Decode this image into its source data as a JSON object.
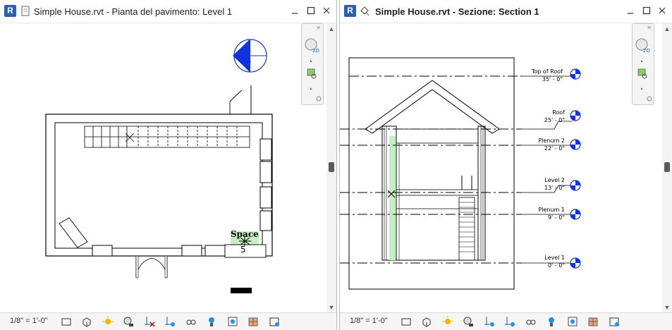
{
  "left_view": {
    "title": "Simple House.rvt - Pianta del pavimento: Level 1",
    "scale": "1/8\" = 1'-0\"",
    "space_tag": {
      "label": "Space",
      "number": "5"
    },
    "elevation_tag": {
      "top": ".",
      "bottom": "..."
    }
  },
  "right_view": {
    "title": "Simple House.rvt - Sezione: Section 1",
    "scale": "1/8\" = 1'-0\"",
    "levels": [
      {
        "name": "Top of Roof",
        "elevation": "35' - 0\""
      },
      {
        "name": "Roof",
        "elevation": "25' - 0\""
      },
      {
        "name": "Plenum 2",
        "elevation": "22' - 0\""
      },
      {
        "name": "Level 2",
        "elevation": "13' - 0\""
      },
      {
        "name": "Plenum 1",
        "elevation": "9' - 0\""
      },
      {
        "name": "Level 1",
        "elevation": "0' - 0\""
      }
    ]
  },
  "app": {
    "logo": "R"
  },
  "icons": [
    "model-graphics-icon",
    "visual-style-icon",
    "sun-path-icon",
    "shadows-icon",
    "crop-view-icon",
    "show-crop-icon",
    "temporary-hide-icon",
    "reveal-hidden-icon",
    "analytical-model-icon",
    "highlight-displacement-icon",
    "worksharing-icon",
    "constraints-icon"
  ],
  "colors": {
    "accent": "#1133dd",
    "space_fill": "#c8ecc4",
    "logo": "#2a5fb3"
  }
}
